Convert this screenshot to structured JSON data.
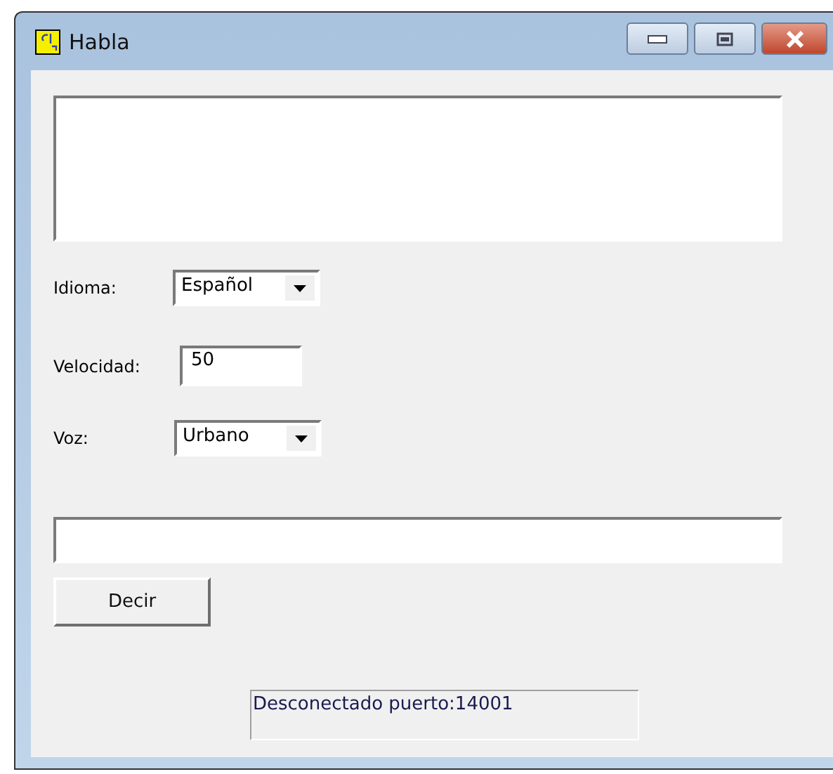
{
  "window": {
    "title": "Habla"
  },
  "form": {
    "idioma": {
      "label": "Idioma:",
      "value": "Español"
    },
    "velocidad": {
      "label": "Velocidad:",
      "value": "50"
    },
    "voz": {
      "label": "Voz:",
      "value": "Urbano"
    }
  },
  "button": "Decir",
  "status_bar": "Desconectado puerto:14001"
}
